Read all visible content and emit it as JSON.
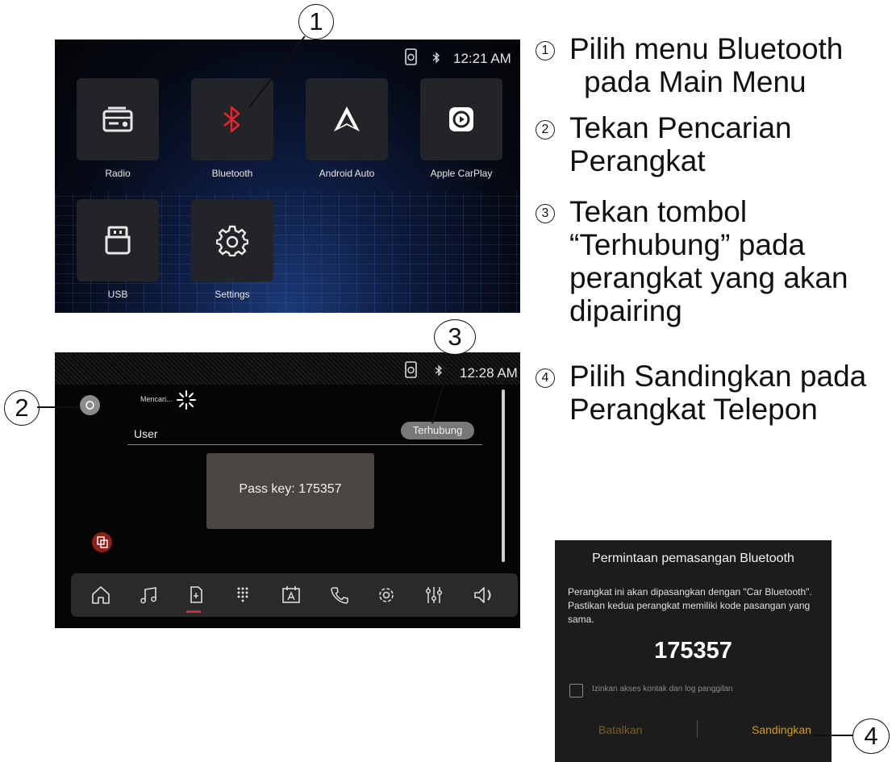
{
  "screen1": {
    "time": "12:21 AM",
    "apps": [
      {
        "label": "Radio",
        "icon": "radio-icon"
      },
      {
        "label": "Bluetooth",
        "icon": "bluetooth-icon"
      },
      {
        "label": "Android Auto",
        "icon": "android-auto-icon"
      },
      {
        "label": "Apple CarPlay",
        "icon": "carplay-icon"
      },
      {
        "label": "USB",
        "icon": "usb-icon"
      },
      {
        "label": "Settings",
        "icon": "gear-icon"
      }
    ]
  },
  "screen2": {
    "time": "12:28 AM",
    "searching": "Mencari...",
    "device_name": "User",
    "connect_label": "Terhubung",
    "passkey_text": "Pass key: 175357",
    "dock": [
      "home-icon",
      "music-icon",
      "phone-connect-icon",
      "dialpad-icon",
      "contacts-icon",
      "call-icon",
      "gear-icon",
      "equalizer-icon",
      "volume-icon"
    ]
  },
  "dialog": {
    "title": "Permintaan pemasangan Bluetooth",
    "message": "Perangkat ini akan dipasangkan dengan \"Car Bluetooth\". Pastikan kedua perangkat memiliki kode pasangan yang sama.",
    "code": "175357",
    "checkbox_label": "Izinkan akses kontak dan log panggilan",
    "checkbox_checked": false,
    "cancel_label": "Batalkan",
    "pair_label": "Sandingkan",
    "accent": "#d9a000"
  },
  "callouts": [
    "1",
    "2",
    "3",
    "4"
  ],
  "steps": [
    {
      "num": "1",
      "lines": [
        "Pilih menu Bluetooth",
        "pada Main Menu"
      ]
    },
    {
      "num": "2",
      "lines": [
        "Tekan Pencarian",
        "Perangkat"
      ]
    },
    {
      "num": "3",
      "lines": [
        "Tekan tombol",
        "“Terhubung” pada",
        "perangkat yang akan",
        "dipairing"
      ]
    },
    {
      "num": "4",
      "lines": [
        "Pilih Sandingkan pada",
        "Perangkat Telepon"
      ]
    }
  ]
}
